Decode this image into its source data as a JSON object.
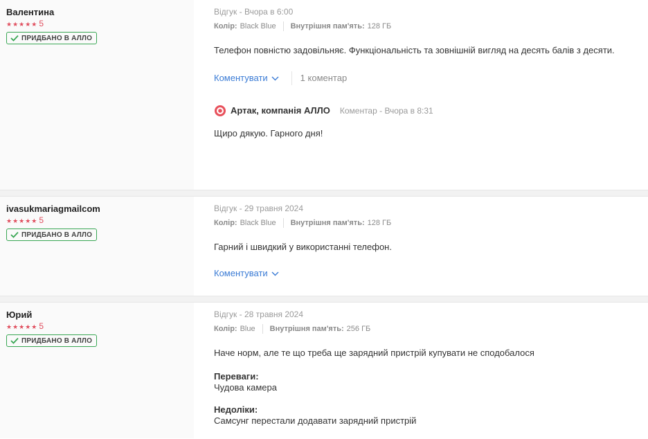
{
  "reviews": [
    {
      "author": "Валентина",
      "rating": "5",
      "badge": "ПРИДБАНО В АЛЛО",
      "meta": "Відгук - Вчора в 6:00",
      "color_label": "Колір:",
      "color_value": "Black Blue",
      "memory_label": "Внутрішня пам'ять:",
      "memory_value": "128 ГБ",
      "text": "Телефон повністю задовільняє. Функціональність та зовнішній вигляд на десять балів з десяти.",
      "comment_label": "Коментувати",
      "comment_count": "1 коментар",
      "reply": {
        "author": "Артак, компанія АЛЛО",
        "meta": "Коментар - Вчора в 8:31",
        "text": "Щиро дякую. Гарного дня!"
      }
    },
    {
      "author": "ivasukmariagmailcom",
      "rating": "5",
      "badge": "ПРИДБАНО В АЛЛО",
      "meta": "Відгук - 29 травня 2024",
      "color_label": "Колір:",
      "color_value": "Black Blue",
      "memory_label": "Внутрішня пам'ять:",
      "memory_value": "128 ГБ",
      "text": "Гарний і швидкий у використанні телефон.",
      "comment_label": "Коментувати"
    },
    {
      "author": "Юрий",
      "rating": "5",
      "badge": "ПРИДБАНО В АЛЛО",
      "meta": "Відгук - 28 травня 2024",
      "color_label": "Колір:",
      "color_value": "Blue",
      "memory_label": "Внутрішня пам'ять:",
      "memory_value": "256 ГБ",
      "text": "Наче норм, але те що треба ще зарядний пристрій купувати не сподобалося",
      "pros_label": "Переваги:",
      "pros_text": "Чудова камера",
      "cons_label": "Недоліки:",
      "cons_text": "Самсунг перестали додавати зарядний пристрій"
    }
  ],
  "colors": {
    "star": "#e04e5e",
    "badge_border": "#38a653",
    "link": "#3a7bd5"
  }
}
